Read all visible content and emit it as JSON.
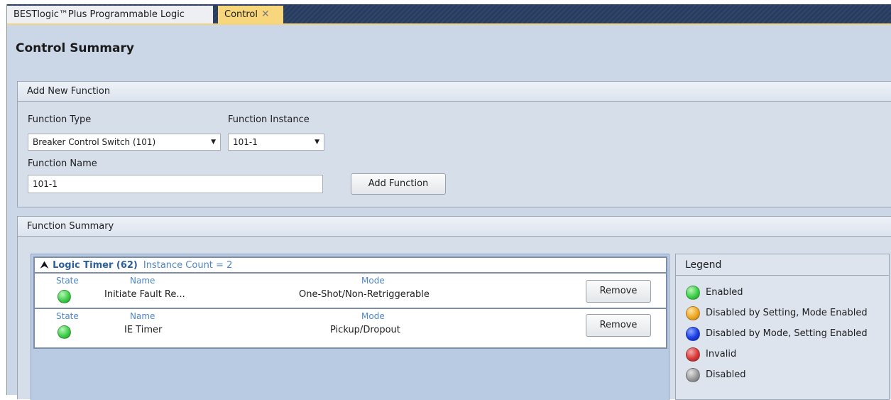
{
  "tabs": [
    {
      "label": "BESTlogic™Plus Programmable Logic",
      "active": false
    },
    {
      "label": "Control",
      "active": true
    }
  ],
  "page": {
    "title": "Control Summary"
  },
  "add_function": {
    "header": "Add New Function",
    "function_type_label": "Function Type",
    "function_type_value": "Breaker Control Switch (101)",
    "function_instance_label": "Function Instance",
    "function_instance_value": "101-1",
    "function_name_label": "Function Name",
    "function_name_value": "101-1",
    "add_button": "Add Function"
  },
  "function_summary": {
    "header": "Function Summary",
    "group": {
      "title": "Logic Timer (62)",
      "instance_count": "Instance Count = 2",
      "rows": [
        {
          "state_label": "State",
          "name_label": "Name",
          "name": "Initiate Fault Re...",
          "mode_label": "Mode",
          "mode": "One-Shot/Non-Retriggerable",
          "remove_label": "Remove",
          "state_color": "#3fcf4a"
        },
        {
          "state_label": "State",
          "name_label": "Name",
          "name": "IE Timer",
          "mode_label": "Mode",
          "mode": "Pickup/Dropout",
          "remove_label": "Remove",
          "state_color": "#3fcf4a"
        }
      ]
    }
  },
  "legend": {
    "title": "Legend",
    "items": [
      {
        "label": "Enabled",
        "color": "#3fcf4a"
      },
      {
        "label": "Disabled by Setting, Mode Enabled",
        "color": "#f0a623"
      },
      {
        "label": "Disabled by Mode, Setting Enabled",
        "color": "#1a3ee6"
      },
      {
        "label": "Invalid",
        "color": "#d83a3a"
      },
      {
        "label": "Disabled",
        "color": "#9a9a9a"
      }
    ]
  },
  "icons": {
    "close": "close-icon",
    "collapse": "double-chevron-up-icon",
    "dropdown": "chevron-down-icon"
  }
}
